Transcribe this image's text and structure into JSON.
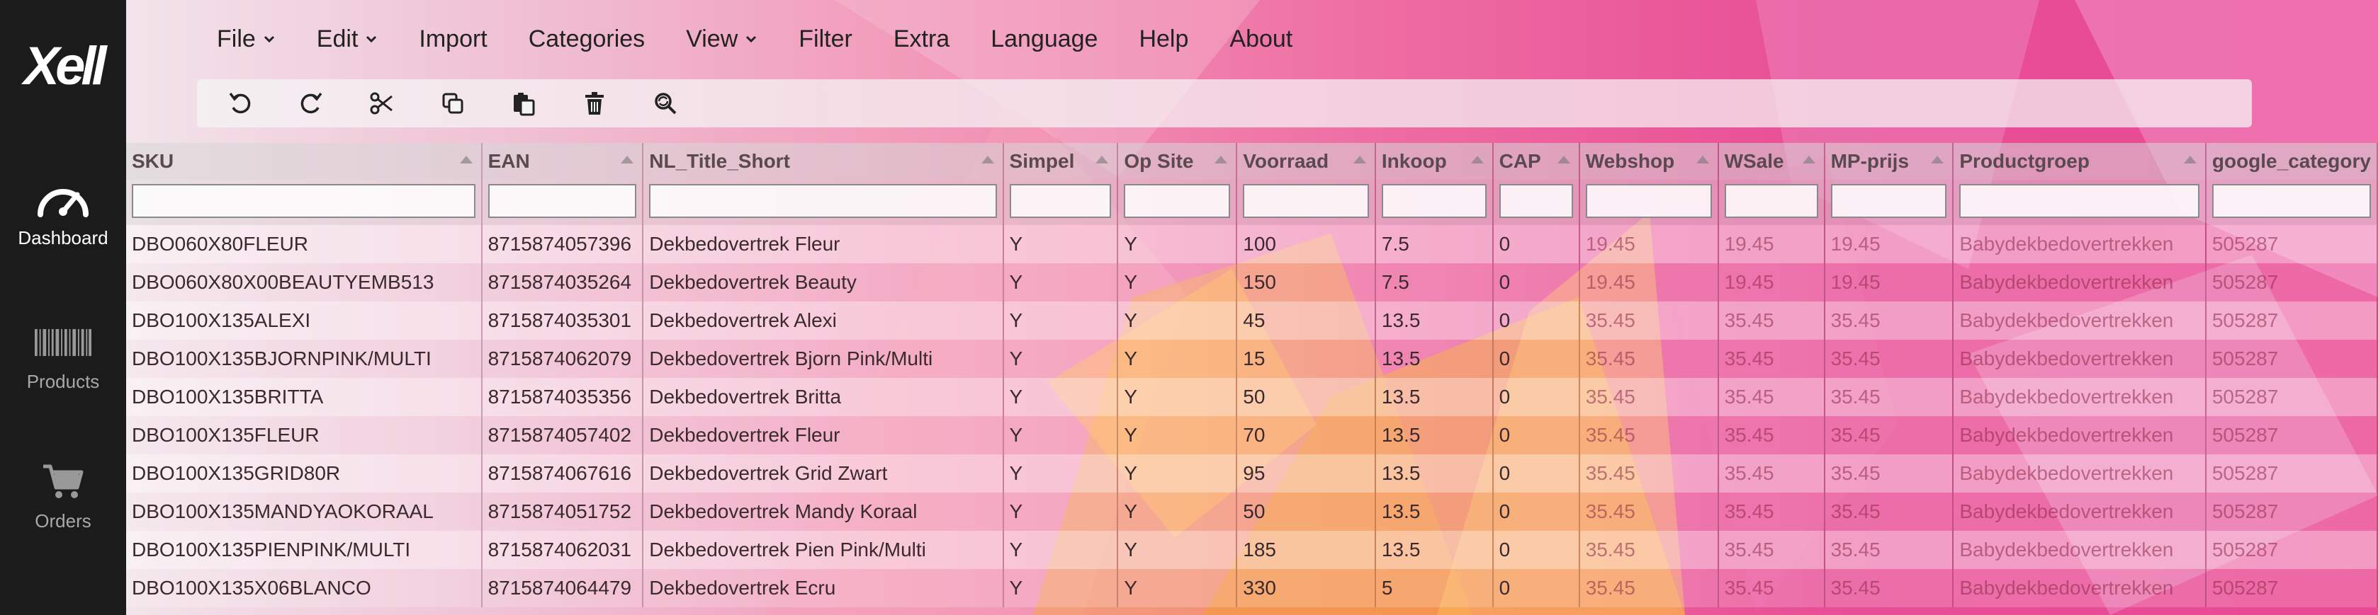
{
  "app": {
    "logo": "Xell"
  },
  "sidebar": {
    "items": [
      {
        "label": "Dashboard",
        "icon": "gauge-icon"
      },
      {
        "label": "Products",
        "icon": "barcode-icon"
      },
      {
        "label": "Orders",
        "icon": "cart-icon"
      }
    ]
  },
  "menu": {
    "items": [
      {
        "label": "File",
        "dropdown": true
      },
      {
        "label": "Edit",
        "dropdown": true
      },
      {
        "label": "Import",
        "dropdown": false
      },
      {
        "label": "Categories",
        "dropdown": false
      },
      {
        "label": "View",
        "dropdown": true
      },
      {
        "label": "Filter",
        "dropdown": false
      },
      {
        "label": "Extra",
        "dropdown": false
      },
      {
        "label": "Language",
        "dropdown": false
      },
      {
        "label": "Help",
        "dropdown": false
      },
      {
        "label": "About",
        "dropdown": false
      }
    ]
  },
  "toolbar": {
    "buttons": [
      "undo-icon",
      "redo-icon",
      "cut-icon",
      "copy-icon",
      "paste-icon",
      "delete-icon",
      "find-replace-icon"
    ]
  },
  "grid": {
    "columns": [
      "SKU",
      "EAN",
      "NL_Title_Short",
      "Simpel",
      "Op Site",
      "Voorraad",
      "Inkoop",
      "CAP",
      "Webshop",
      "WSale",
      "MP-prijs",
      "Productgroep",
      "google_category"
    ],
    "rows": [
      [
        "DBO060X80FLEUR",
        "8715874057396",
        "Dekbedovertrek Fleur",
        "Y",
        "Y",
        "100",
        "7.5",
        "0",
        "19.45",
        "19.45",
        "19.45",
        "Babydekbedovertrekken",
        "505287"
      ],
      [
        "DBO060X80X00BEAUTYEMB513",
        "8715874035264",
        "Dekbedovertrek Beauty",
        "Y",
        "Y",
        "150",
        "7.5",
        "0",
        "19.45",
        "19.45",
        "19.45",
        "Babydekbedovertrekken",
        "505287"
      ],
      [
        "DBO100X135ALEXI",
        "8715874035301",
        "Dekbedovertrek Alexi",
        "Y",
        "Y",
        "45",
        "13.5",
        "0",
        "35.45",
        "35.45",
        "35.45",
        "Babydekbedovertrekken",
        "505287"
      ],
      [
        "DBO100X135BJORNPINK/MULTI",
        "8715874062079",
        "Dekbedovertrek Bjorn Pink/Multi",
        "Y",
        "Y",
        "15",
        "13.5",
        "0",
        "35.45",
        "35.45",
        "35.45",
        "Babydekbedovertrekken",
        "505287"
      ],
      [
        "DBO100X135BRITTA",
        "8715874035356",
        "Dekbedovertrek Britta",
        "Y",
        "Y",
        "50",
        "13.5",
        "0",
        "35.45",
        "35.45",
        "35.45",
        "Babydekbedovertrekken",
        "505287"
      ],
      [
        "DBO100X135FLEUR",
        "8715874057402",
        "Dekbedovertrek Fleur",
        "Y",
        "Y",
        "70",
        "13.5",
        "0",
        "35.45",
        "35.45",
        "35.45",
        "Babydekbedovertrekken",
        "505287"
      ],
      [
        "DBO100X135GRID80R",
        "8715874067616",
        "Dekbedovertrek Grid Zwart",
        "Y",
        "Y",
        "95",
        "13.5",
        "0",
        "35.45",
        "35.45",
        "35.45",
        "Babydekbedovertrekken",
        "505287"
      ],
      [
        "DBO100X135MANDYAOKORAAL",
        "8715874051752",
        "Dekbedovertrek Mandy Koraal",
        "Y",
        "Y",
        "50",
        "13.5",
        "0",
        "35.45",
        "35.45",
        "35.45",
        "Babydekbedovertrekken",
        "505287"
      ],
      [
        "DBO100X135PIENPINK/MULTI",
        "8715874062031",
        "Dekbedovertrek Pien Pink/Multi",
        "Y",
        "Y",
        "185",
        "13.5",
        "0",
        "35.45",
        "35.45",
        "35.45",
        "Babydekbedovertrekken",
        "505287"
      ],
      [
        "DBO100X135X06BLANCO",
        "8715874064479",
        "Dekbedovertrek Ecru",
        "Y",
        "Y",
        "330",
        "5",
        "0",
        "35.45",
        "35.45",
        "35.45",
        "Babydekbedovertrekken",
        "505287"
      ]
    ]
  },
  "colors": {
    "sidebar_bg": "#1b1b1b",
    "accent_pink": "#e84f96",
    "accent_orange": "#f4a24a"
  }
}
